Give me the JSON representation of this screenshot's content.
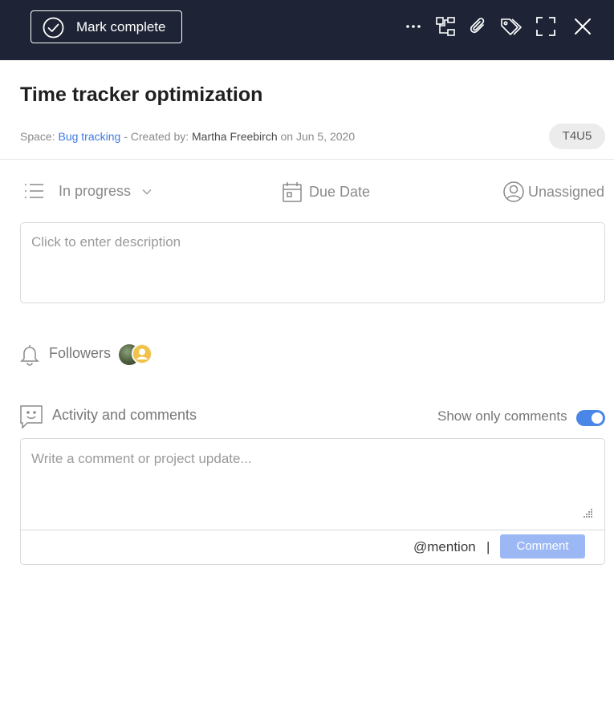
{
  "toolbar": {
    "mark_complete_label": "Mark complete",
    "icons": [
      "check-circle-icon",
      "more-icon",
      "subtasks-icon",
      "attachment-icon",
      "tags-icon",
      "fullscreen-icon",
      "close-icon"
    ]
  },
  "task": {
    "title": "Time tracker optimization",
    "space_prefix": "Space: ",
    "space_name": "Bug tracking",
    "created_prefix": " - Created by: ",
    "creator": "Martha Freebirch",
    "created_on": " on Jun 5, 2020",
    "id": "T4U5"
  },
  "properties": {
    "status": "In progress",
    "due_date": "Due Date",
    "assignee": "Unassigned"
  },
  "description": {
    "placeholder": "Click to enter description"
  },
  "followers": {
    "label": "Followers"
  },
  "activity": {
    "label": "Activity and comments",
    "show_only_comments_label": "Show only comments",
    "show_only_comments": true
  },
  "comment": {
    "placeholder": "Write a comment or project update...",
    "mention_label": "@mention",
    "separator": "|",
    "submit_label": "Comment"
  },
  "colors": {
    "topbar": "#1e2435",
    "accent": "#4a86e8",
    "link": "#3f7be0",
    "submit_disabled": "#9bb8f5"
  }
}
